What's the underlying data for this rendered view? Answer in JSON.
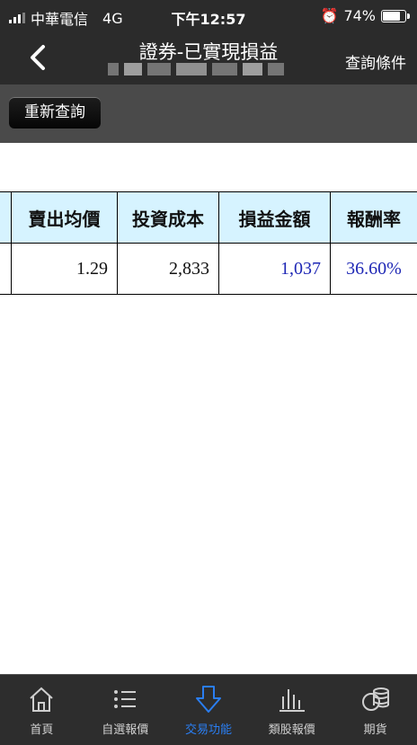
{
  "status_bar": {
    "carrier": "中華電信",
    "network": "4G",
    "time": "下午12:57",
    "battery": "74%"
  },
  "nav": {
    "title": "證券-已實現損益",
    "query_conditions": "查詢條件"
  },
  "toolbar": {
    "requery_label": "重新查詢"
  },
  "table": {
    "headers": [
      "賣出均價",
      "投資成本",
      "損益金額",
      "報酬率"
    ],
    "rows": [
      {
        "avg_sell_price": "1.29",
        "investment_cost": "2,833",
        "profit_loss": "1,037",
        "return_rate": "36.60%"
      }
    ]
  },
  "tabbar": {
    "tabs": [
      {
        "label": "首頁",
        "icon": "home-icon"
      },
      {
        "label": "自選報價",
        "icon": "list-icon"
      },
      {
        "label": "交易功能",
        "icon": "down-arrow-icon",
        "active": true
      },
      {
        "label": "類股報價",
        "icon": "bar-chart-icon"
      },
      {
        "label": "期貨",
        "icon": "coins-icon"
      }
    ]
  },
  "colors": {
    "top_bar": "#2b2b2b",
    "toolbar": "#4a4a4a",
    "header_bg": "#d6f3ff",
    "accent_blue": "#1e27b5",
    "active_tab": "#2a7ef2"
  }
}
